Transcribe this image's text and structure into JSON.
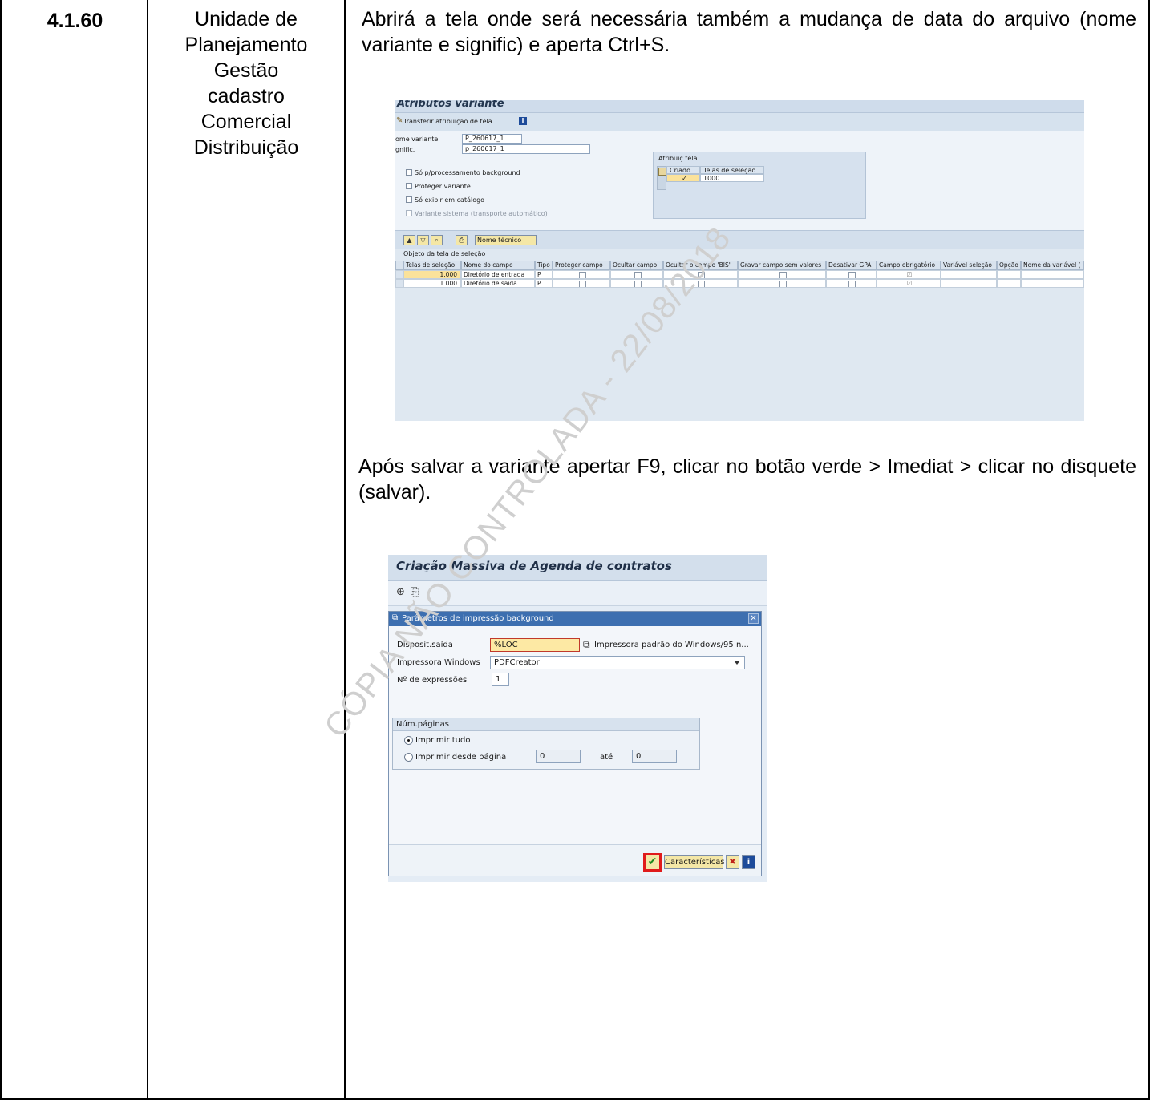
{
  "step_number": "4.1.60",
  "unit_lines": [
    "Unidade de",
    "Planejamento",
    "Gestão",
    "cadastro",
    "Comercial",
    "Distribuição"
  ],
  "paragraph_1": "Abrirá a tela onde será necessária também a mudança de data do arquivo (nome variante e signific) e aperta Ctrl+S.",
  "paragraph_2": "Após salvar a variante apertar F9, clicar no botão verde > Imediat > clicar no disquete (salvar).",
  "watermark": "CÓPIA NÃO CONTROLADA - 22/08/2018",
  "screenshot_variant": {
    "title": "Atributos variante",
    "toolbar_label": "Transferir atribuição de tela",
    "nome_variante_label": "ome variante",
    "nome_variante_value": "P_260617_1",
    "signific_label": "gnific.",
    "signific_value": "p_260617_1",
    "options": [
      {
        "label": "Só p/processamento background",
        "checked": false
      },
      {
        "label": "Proteger variante",
        "checked": false
      },
      {
        "label": "Só exibir em catálogo",
        "checked": false
      },
      {
        "label": "Variante sistema (transporte automático)",
        "checked": false
      }
    ],
    "group_title": "Atribuiç.tela",
    "group_cols": [
      "Criado",
      "Telas de seleção"
    ],
    "group_row": {
      "criado": "✓",
      "tela": "1000"
    },
    "tech_button": "Nome técnico",
    "grid_title": "Objeto da tela de seleção",
    "grid_columns": [
      "Telas de seleção",
      "Nome do campo",
      "Tipo",
      "Proteger campo",
      "Ocultar campo",
      "Ocultar o campo 'BIS'",
      "Gravar campo sem valores",
      "Desativar GPA",
      "Campo obrigatório",
      "Variável seleção",
      "Opção",
      "Nome da variável ("
    ],
    "grid_rows": [
      {
        "tela": "1.000",
        "campo": "Diretório de entrada",
        "tipo": "P"
      },
      {
        "tela": "1.000",
        "campo": "Diretório de saida",
        "tipo": "P"
      }
    ]
  },
  "screenshot_print": {
    "title": "Criação Massiva de Agenda de contratos",
    "dialog_title": "Parâmetros de impressão background",
    "output_label": "Disposit.saída",
    "output_value": "%LOC",
    "output_desc": "Impressora padrão do Windows/95 n...",
    "printer_label": "Impressora Windows",
    "printer_value": "PDFCreator",
    "copies_label": "Nº de expressões",
    "copies_value": "1",
    "pages_group": "Núm.páginas",
    "print_all": "Imprimir tudo",
    "print_from": "Imprimir desde página",
    "from_value": "0",
    "to_label": "até",
    "to_value": "0",
    "button_characteristics": "Características",
    "colors": {
      "highlight": "#e01b1b",
      "dialog_header": "#3d6fb0"
    }
  }
}
